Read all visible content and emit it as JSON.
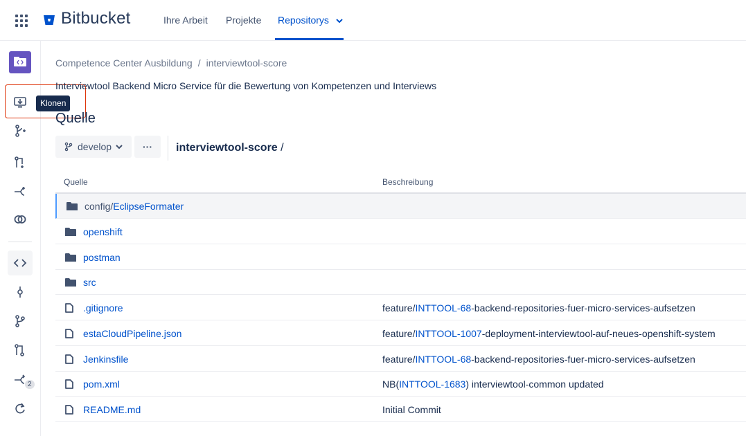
{
  "app": {
    "name": "Bitbucket",
    "brand_color": "#0052cc"
  },
  "topnav": {
    "items": [
      {
        "label": "Ihre Arbeit"
      },
      {
        "label": "Projekte"
      },
      {
        "label": "Repositorys"
      }
    ]
  },
  "sidebar": {
    "tooltip": "Klonen",
    "pull_requests_count": "2",
    "icons": [
      "repo-avatar",
      "clone-icon",
      "create-branch-icon",
      "create-pull-request-icon",
      "fork-icon",
      "compare-icon",
      "source-icon",
      "commits-icon",
      "branches-icon",
      "pull-requests-icon",
      "forks-icon",
      "sync-icon"
    ]
  },
  "breadcrumb": {
    "project": "Competence Center Ausbildung",
    "separator": "/",
    "repo": "interviewtool-score"
  },
  "repo": {
    "description": "Interviewtool Backend Micro Service für die Bewertung von Kompetenzen und Interviews"
  },
  "source": {
    "title": "Quelle",
    "branch": "develop",
    "more_label": "···",
    "path_root": "interviewtool-score",
    "path_sep": "/",
    "columns": {
      "name": "Quelle",
      "description": "Beschreibung"
    },
    "rows": [
      {
        "type": "folder",
        "prefix": "config/",
        "name": "EclipseFormater",
        "desc_pre": "",
        "desc_link": "",
        "desc_post": ""
      },
      {
        "type": "folder",
        "prefix": "",
        "name": "openshift",
        "desc_pre": "",
        "desc_link": "",
        "desc_post": ""
      },
      {
        "type": "folder",
        "prefix": "",
        "name": "postman",
        "desc_pre": "",
        "desc_link": "",
        "desc_post": ""
      },
      {
        "type": "folder",
        "prefix": "",
        "name": "src",
        "desc_pre": "",
        "desc_link": "",
        "desc_post": ""
      },
      {
        "type": "file",
        "prefix": "",
        "name": ".gitignore",
        "desc_pre": "feature/",
        "desc_link": "INTTOOL-68",
        "desc_post": "-backend-repositories-fuer-micro-services-aufsetzen"
      },
      {
        "type": "file",
        "prefix": "",
        "name": "estaCloudPipeline.json",
        "desc_pre": "feature/",
        "desc_link": "INTTOOL-1007",
        "desc_post": "-deployment-interviewtool-auf-neues-openshift-system"
      },
      {
        "type": "file",
        "prefix": "",
        "name": "Jenkinsfile",
        "desc_pre": "feature/",
        "desc_link": "INTTOOL-68",
        "desc_post": "-backend-repositories-fuer-micro-services-aufsetzen"
      },
      {
        "type": "file",
        "prefix": "",
        "name": "pom.xml",
        "desc_pre": "NB(",
        "desc_link": "INTTOOL-1683",
        "desc_post": ") interviewtool-common updated"
      },
      {
        "type": "file",
        "prefix": "",
        "name": "README.md",
        "desc_pre": "Initial Commit",
        "desc_link": "",
        "desc_post": ""
      }
    ]
  }
}
